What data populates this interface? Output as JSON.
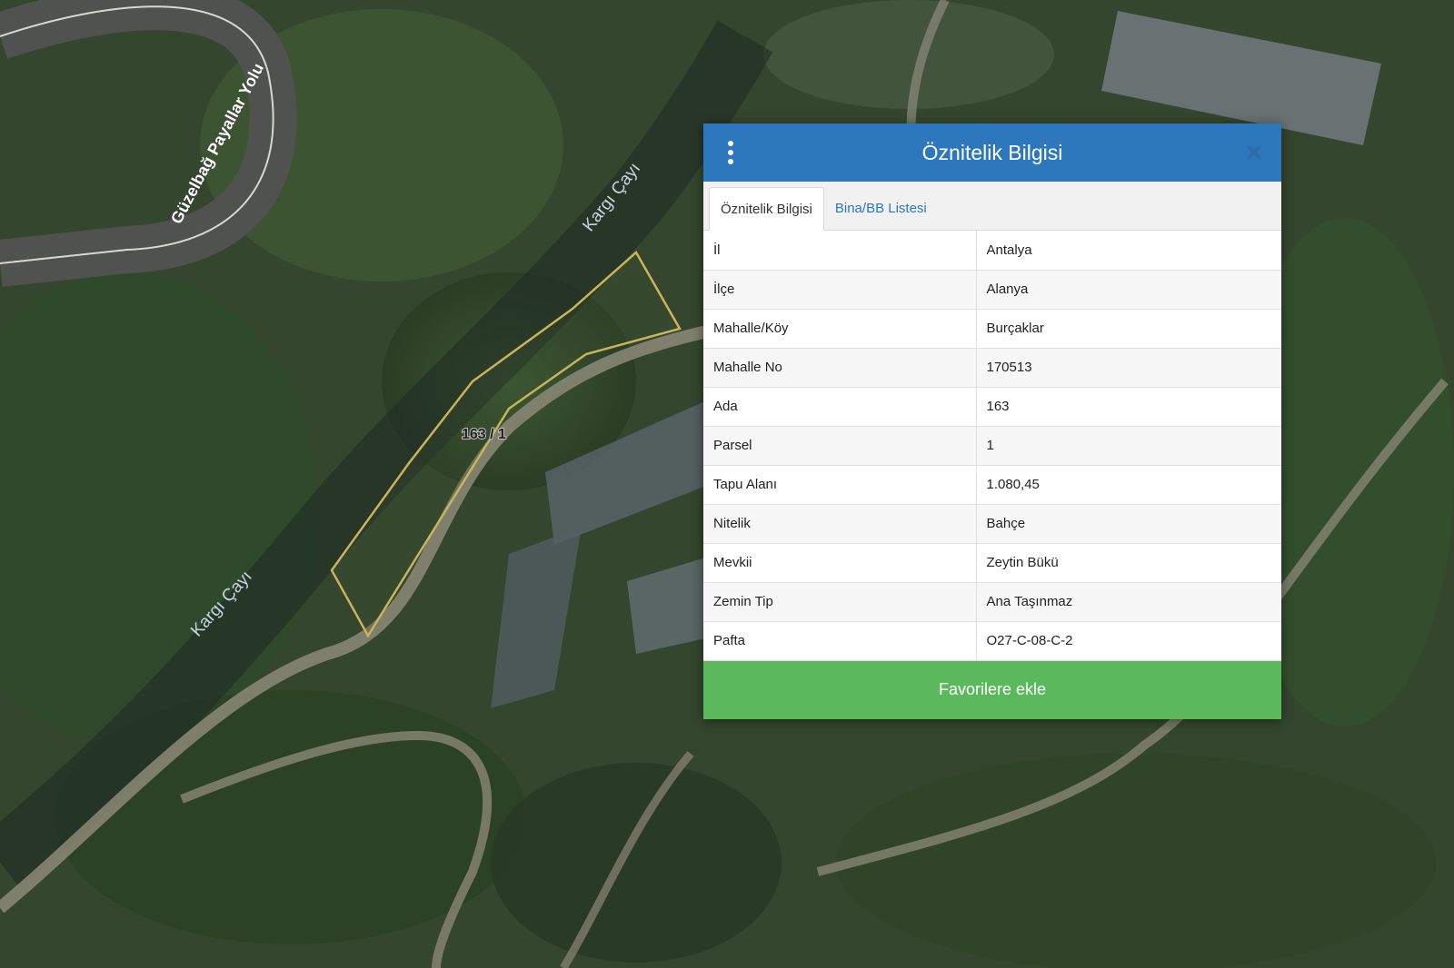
{
  "map": {
    "road_label": "Güzelbağ Payallar Yolu",
    "river_label_1": "Kargı Çayı",
    "river_label_2": "Kargı Çayı",
    "parcel_label": "163 / 1",
    "parcel_outline_color": "#c9b45a"
  },
  "panel": {
    "title": "Öznitelik Bilgisi",
    "menu_icon": "vertical-ellipsis",
    "close_icon": "close-x",
    "header_color": "#2d77bd",
    "tabs": [
      {
        "label": "Öznitelik Bilgisi",
        "active": true
      },
      {
        "label": "Bina/BB Listesi",
        "active": false
      }
    ],
    "rows": [
      {
        "key": "İl",
        "value": "Antalya"
      },
      {
        "key": "İlçe",
        "value": "Alanya"
      },
      {
        "key": "Mahalle/Köy",
        "value": "Burçaklar"
      },
      {
        "key": "Mahalle No",
        "value": "170513"
      },
      {
        "key": "Ada",
        "value": "163"
      },
      {
        "key": "Parsel",
        "value": "1"
      },
      {
        "key": "Tapu Alanı",
        "value": "1.080,45"
      },
      {
        "key": "Nitelik",
        "value": "Bahçe"
      },
      {
        "key": "Mevkii",
        "value": "Zeytin Bükü"
      },
      {
        "key": "Zemin Tip",
        "value": "Ana Taşınmaz"
      },
      {
        "key": "Pafta",
        "value": "O27-C-08-C-2"
      }
    ],
    "favorite_button_label": "Favorilere ekle",
    "favorite_button_color": "#5cb85c"
  }
}
